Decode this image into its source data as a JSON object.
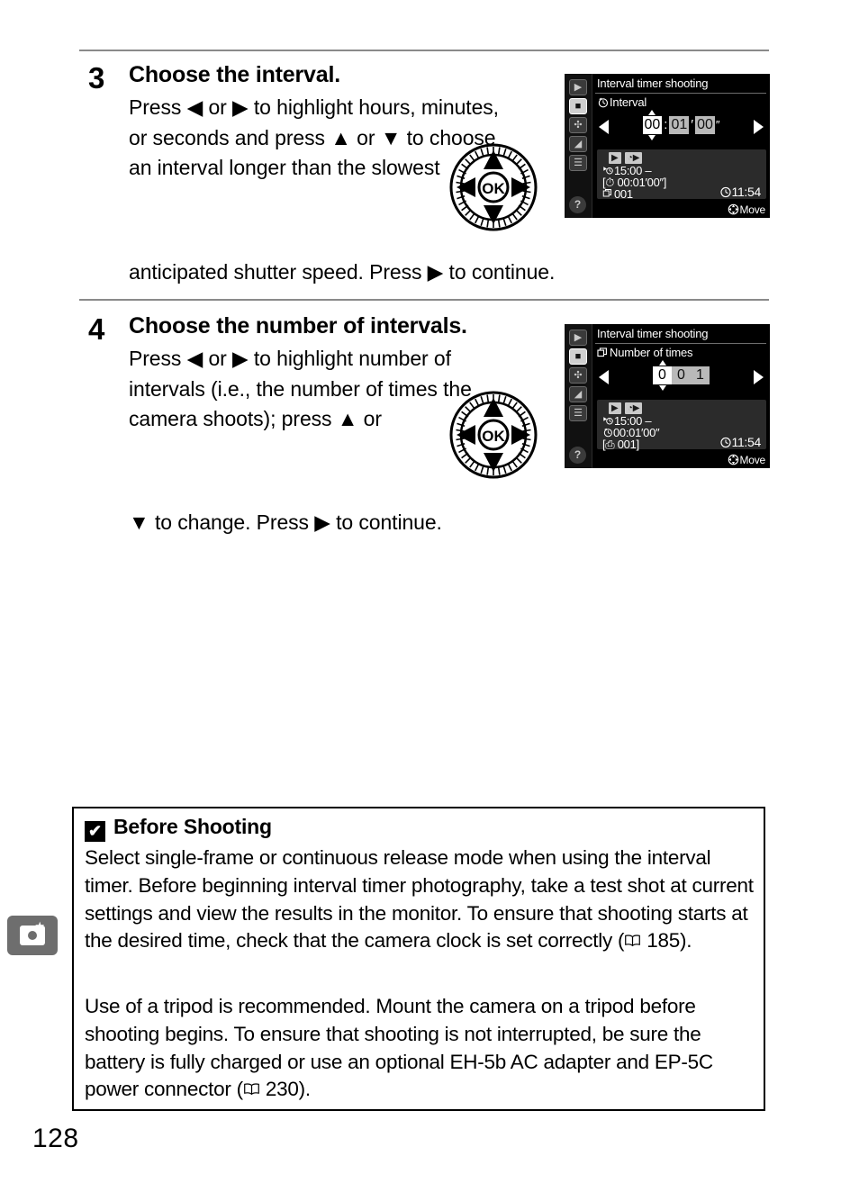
{
  "page": {
    "number": "128",
    "tab_icon": "camera-star-icon"
  },
  "steps": [
    {
      "number": "3",
      "title": "Choose the interval.",
      "text": "Press ◀ or ▶ to highlight hours, minutes, or seconds and press ▲ or ▼ to choose an interval longer than the slowest",
      "text_tail": "anticipated shutter speed.  Press ▶ to continue.",
      "dial_icon": "multi-selector-dial-icon",
      "dial_center_label": "OK"
    },
    {
      "number": "4",
      "title": "Choose the number of intervals.",
      "text": "Press ◀ or ▶ to highlight number of intervals (i.e., the number of times the camera shoots); press ▲ or",
      "text_tail": "▼ to change.  Press ▶ to continue.",
      "dial_icon": "multi-selector-dial-icon",
      "dial_center_label": "OK"
    }
  ],
  "lcd_screens": [
    {
      "title": "Interval timer shooting",
      "subtitle": "Interval",
      "subtitle_icon": "interval-clock-icon",
      "side_icons": [
        "playback-icon",
        "shooting-menu-icon",
        "setup-wrench-icon",
        "retouch-icon",
        "recent-settings-icon"
      ],
      "selected_side_index": 1,
      "help_label": "?",
      "left_arrow_icon": "arrow-left-icon",
      "right_arrow_icon": "arrow-right-icon",
      "digits": [
        {
          "text": "00",
          "highlighted": true
        },
        {
          "text": ":",
          "sep": true
        },
        {
          "text": "01",
          "highlighted": false
        },
        {
          "text": "′",
          "sep": true
        },
        {
          "text": "00",
          "highlighted": false
        },
        {
          "text": "″",
          "tick": true
        }
      ],
      "info": {
        "badges": [
          "▶",
          "◔▶"
        ],
        "line1": "15:00  –",
        "line1_icon": "start-time-icon",
        "line2": "[⏱ 00:01′00″]",
        "line3": "001",
        "line3_icon": "frames-icon",
        "clock": "11:54",
        "clock_icon": "clock-icon"
      },
      "move_label": "Move",
      "move_icon": "multi-selector-small-icon"
    },
    {
      "title": "Interval timer shooting",
      "subtitle": "Number of times",
      "subtitle_icon": "frames-stack-icon",
      "side_icons": [
        "playback-icon",
        "shooting-menu-icon",
        "setup-wrench-icon",
        "retouch-icon",
        "recent-settings-icon"
      ],
      "selected_side_index": 1,
      "help_label": "?",
      "left_arrow_icon": "arrow-left-icon",
      "right_arrow_icon": "arrow-right-icon",
      "digits": [
        {
          "text": "0",
          "highlighted": true
        },
        {
          "text": "0",
          "highlighted": false
        },
        {
          "text": "1",
          "highlighted": false
        }
      ],
      "info": {
        "badges": [
          "▶",
          "◔▶"
        ],
        "line1": "15:00  –",
        "line1_icon": "start-time-icon",
        "line2": "00:01′00″",
        "line3": "[⎙ 001]",
        "line3_icon": "frames-icon",
        "clock": "11:54",
        "clock_icon": "clock-icon"
      },
      "move_label": "Move",
      "move_icon": "multi-selector-small-icon"
    }
  ],
  "note": {
    "mark_icon": "check-warning-icon",
    "mark_glyph": "✔",
    "heading": "Before Shooting",
    "paragraph1": "Select single-frame or continuous release mode when using the interval timer. Before beginning interval timer photography, take a test shot at current settings and view the results in the monitor.  To ensure that shooting starts at the desired time, check that the camera clock is set correctly (",
    "paragraph1_ref": " 185).",
    "paragraph2": "Use of a tripod is recommended.  Mount the camera on a tripod before shooting begins.  To ensure that shooting is not interrupted, be sure the battery is fully charged or use an optional EH-5b AC adapter and EP-5C power connector (",
    "paragraph2_ref": " 230).",
    "book_icon": "book-reference-icon"
  }
}
